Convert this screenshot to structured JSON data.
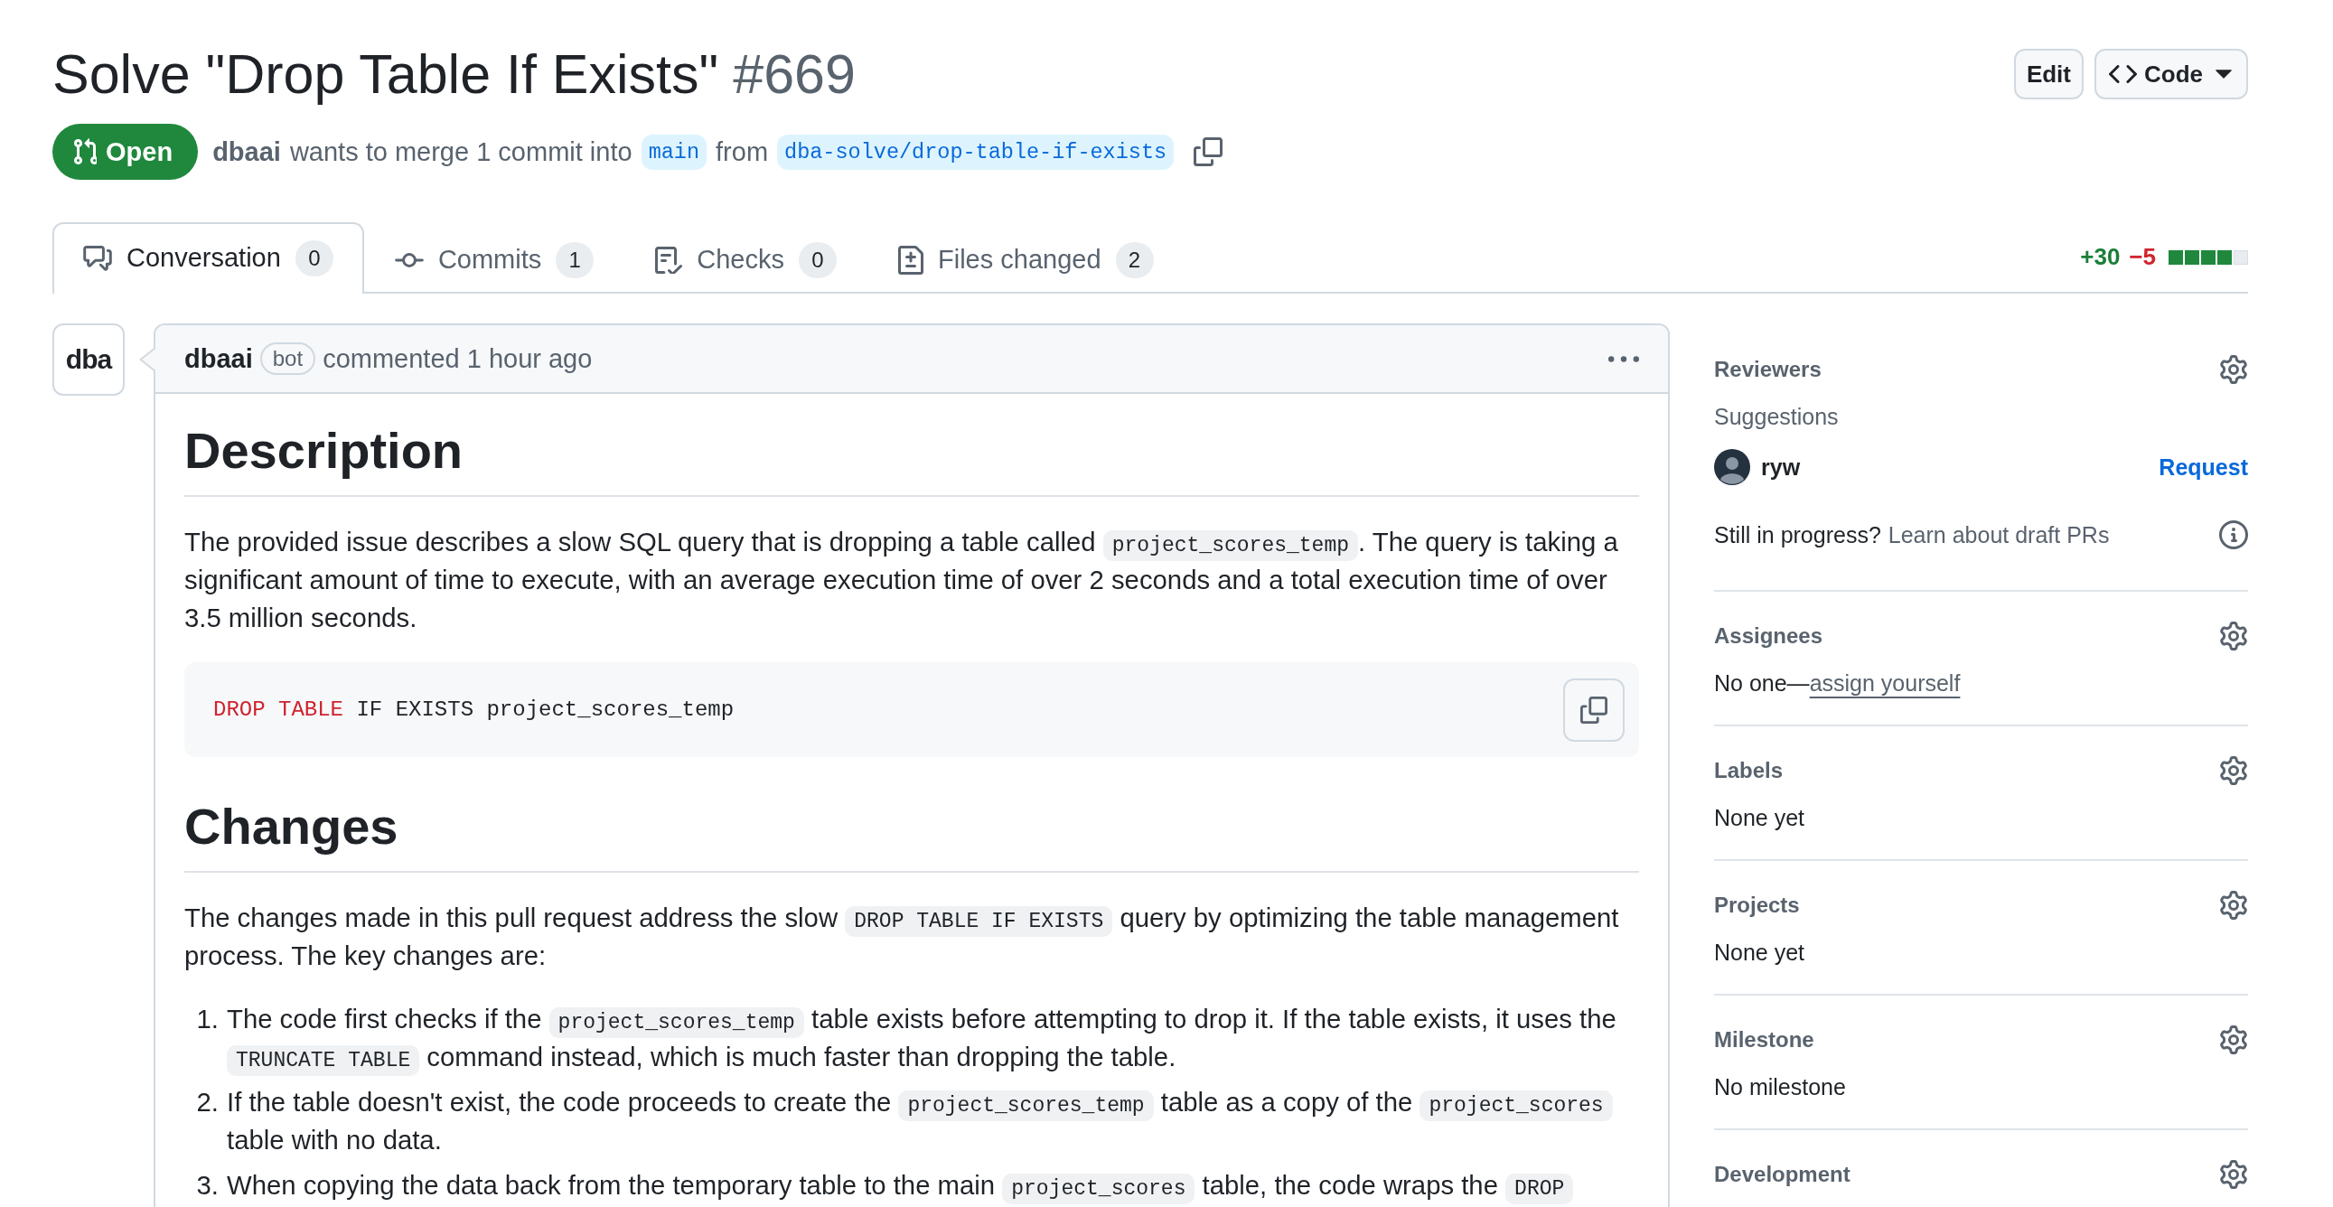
{
  "header": {
    "title": "Solve \"Drop Table If Exists\"",
    "number": "#669",
    "buttons": [
      {
        "kind": "plain",
        "label": "Edit"
      },
      {
        "kind": "menu",
        "label": "Code"
      }
    ]
  },
  "state": {
    "kind": "open",
    "label": "Open"
  },
  "merge_info": {
    "author": "dbaai",
    "text": "wants to merge 1 commit into",
    "base_branch": "main",
    "joiner": "from",
    "head_branch": "dba-solve/drop-table-if-exists"
  },
  "tabs": [
    {
      "label": "Conversation",
      "count": "0",
      "selected": true
    },
    {
      "label": "Commits",
      "count": "1",
      "selected": false
    },
    {
      "label": "Checks",
      "count": "0",
      "selected": false
    },
    {
      "label": "Files changed",
      "count": "2",
      "selected": false
    }
  ],
  "diffstat": {
    "additions": "+30",
    "deletions": "−5",
    "blocks": [
      {
        "kind": "added"
      },
      {
        "kind": "added"
      },
      {
        "kind": "added"
      },
      {
        "kind": "added"
      },
      {
        "kind": "neutral"
      }
    ]
  },
  "comment": {
    "avatar_text": "dba",
    "author": "dbaai",
    "badge": "bot",
    "action": "commented 1 hour ago",
    "body": [
      {
        "kind": "heading",
        "text": "Description"
      },
      {
        "kind": "paragraph",
        "parts": [
          {
            "kind": "text",
            "text": "The provided issue describes a slow SQL query that is dropping a table called "
          },
          {
            "kind": "code",
            "text": "project_scores_temp"
          },
          {
            "kind": "text",
            "text": ". The query is taking a significant amount of time to execute, with an average execution time of over 2 seconds and a total execution time of over 3.5 million seconds."
          }
        ]
      },
      {
        "kind": "code_block",
        "tokens": [
          {
            "kind": "keyword",
            "text": "DROP TABLE"
          },
          {
            "kind": "plain",
            "text": " IF EXISTS project_scores_temp"
          }
        ]
      },
      {
        "kind": "heading",
        "text": "Changes"
      },
      {
        "kind": "paragraph",
        "parts": [
          {
            "kind": "text",
            "text": "The changes made in this pull request address the slow "
          },
          {
            "kind": "code",
            "text": "DROP TABLE IF EXISTS"
          },
          {
            "kind": "text",
            "text": " query by optimizing the table management process. The key changes are:"
          }
        ]
      },
      {
        "kind": "list",
        "items": [
          {
            "number": "1.",
            "parts": [
              {
                "kind": "text",
                "text": "The code first checks if the "
              },
              {
                "kind": "code",
                "text": "project_scores_temp"
              },
              {
                "kind": "text",
                "text": " table exists before attempting to drop it. If the table exists, it uses the "
              },
              {
                "kind": "code",
                "text": "TRUNCATE TABLE"
              },
              {
                "kind": "text",
                "text": " command instead, which is much faster than dropping the table."
              }
            ]
          },
          {
            "number": "2.",
            "parts": [
              {
                "kind": "text",
                "text": "If the table doesn't exist, the code proceeds to create the "
              },
              {
                "kind": "code",
                "text": "project_scores_temp"
              },
              {
                "kind": "text",
                "text": " table as a copy of the "
              },
              {
                "kind": "code",
                "text": "project_scores"
              },
              {
                "kind": "text",
                "text": " table with no data."
              }
            ]
          },
          {
            "number": "3.",
            "parts": [
              {
                "kind": "text",
                "text": "When copying the data back from the temporary table to the main "
              },
              {
                "kind": "code",
                "text": "project_scores"
              },
              {
                "kind": "text",
                "text": " table, the code wraps the "
              },
              {
                "kind": "code",
                "text": "DROP"
              }
            ]
          }
        ]
      }
    ]
  },
  "sidebar": [
    {
      "kind": "reviewers",
      "heading": "Reviewers",
      "subheading": "Suggestions",
      "suggestions": [
        {
          "name": "ryw",
          "action": "Request"
        }
      ],
      "note": "Still in progress?",
      "note_link": "Learn about draft PRs"
    },
    {
      "kind": "assignees",
      "heading": "Assignees",
      "value": "No one—",
      "link": "assign yourself"
    },
    {
      "kind": "plain",
      "heading": "Labels",
      "value": "None yet"
    },
    {
      "kind": "plain",
      "heading": "Projects",
      "value": "None yet"
    },
    {
      "kind": "plain",
      "heading": "Milestone",
      "value": "No milestone"
    },
    {
      "kind": "plain",
      "heading": "Development"
    }
  ]
}
